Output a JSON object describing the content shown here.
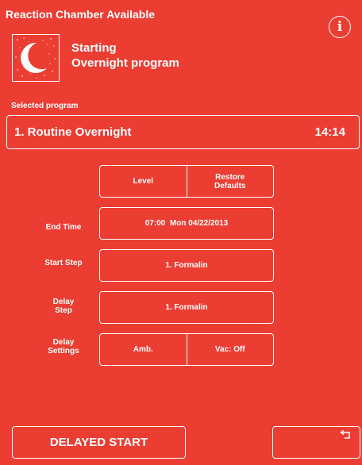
{
  "header": {
    "title": "Reaction Chamber Available",
    "info_glyph": "i"
  },
  "status": {
    "icon": "moon-icon",
    "line1": "Starting",
    "line2": "Overnight program"
  },
  "selected_program": {
    "label": "Selected program",
    "name": "1. Routine Overnight",
    "time": "14:14"
  },
  "options": {
    "level_label": "Level",
    "restore_defaults_line1": "Restore",
    "restore_defaults_line2": "Defaults"
  },
  "end_time": {
    "label": "End Time",
    "value": "07:00  Mon 04/22/2013"
  },
  "start_step": {
    "label": "Start Step",
    "value": "1. Formalin"
  },
  "delay_step": {
    "label_line1": "Delay",
    "label_line2": "Step",
    "value": "1. Formalin"
  },
  "delay_settings": {
    "label_line1": "Delay",
    "label_line2": "Settings",
    "left_value": "Amb.",
    "right_value": "Vac: Off"
  },
  "footer": {
    "delayed_start_label": "DELAYED START",
    "back_icon": "return-arrow-icon"
  },
  "colors": {
    "background": "#ec3d32",
    "foreground": "#ffffff"
  }
}
